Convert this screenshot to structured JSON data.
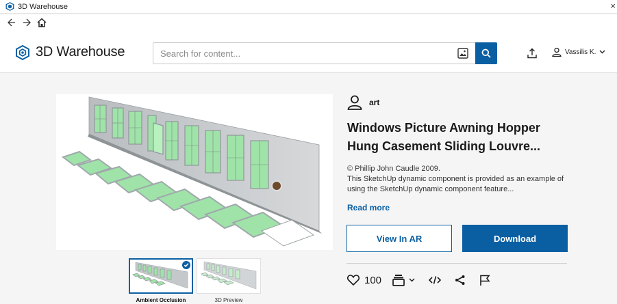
{
  "window": {
    "title": "3D Warehouse",
    "close_glyph": "×"
  },
  "nav": {
    "back_icon": "back-arrow-icon",
    "forward_icon": "forward-arrow-icon",
    "home_icon": "home-icon"
  },
  "header": {
    "brand": "3D Warehouse",
    "search_placeholder": "Search for content...",
    "user_name": "Vassilis K."
  },
  "model": {
    "author": "art",
    "title": "Windows Picture Awning Hopper Hung Casement Sliding Louvre...",
    "description_line1": "© Phillip John Caudle 2009.",
    "description_line2": "This SketchUp dynamic component is provided as an example of using the SketchUp dynamic component feature...",
    "read_more": "Read more",
    "likes": "100"
  },
  "buttons": {
    "ar": "View In AR",
    "download": "Download"
  },
  "thumbnails": [
    {
      "label": "Ambient Occlusion",
      "selected": true
    },
    {
      "label": "3D Preview",
      "selected": false
    }
  ],
  "colors": {
    "accent": "#0a5fa3",
    "window_glass": "#9fe3a8",
    "frame": "#a9b0b4"
  }
}
